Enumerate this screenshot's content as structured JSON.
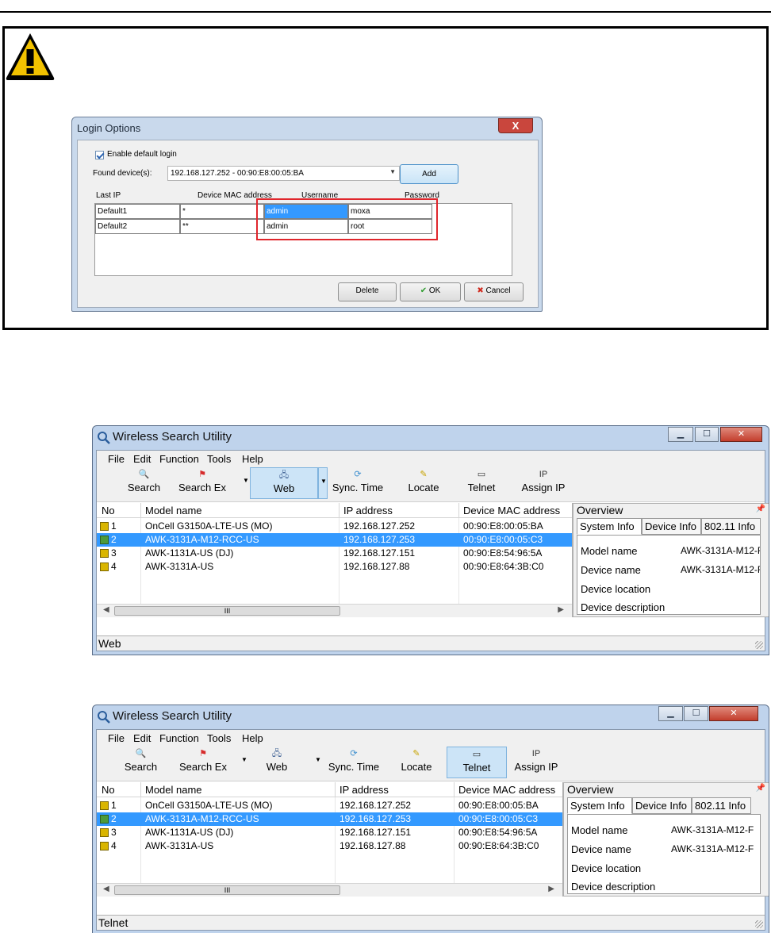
{
  "login_dialog": {
    "title": "Login Options",
    "close_label": "X",
    "enable_default_login": "Enable default login",
    "found_devices_label": "Found device(s):",
    "found_devices_value": "192.168.127.252 - 00:90:E8:00:05:BA",
    "add_button": "Add",
    "columns": [
      "Last IP",
      "Device MAC address",
      "Username",
      "Password"
    ],
    "rows": [
      {
        "last_ip": "Default1",
        "mac": "*",
        "username": "admin",
        "password": "moxa"
      },
      {
        "last_ip": "Default2",
        "mac": "**",
        "username": "admin",
        "password": "root"
      }
    ],
    "delete_button": "Delete",
    "ok_button": "OK",
    "cancel_button": "Cancel"
  },
  "windows": [
    {
      "title": "Wireless Search Utility",
      "menu": [
        "File",
        "Edit",
        "Function",
        "Tools",
        "Help"
      ],
      "toolbar": [
        "Search",
        "Search Ex",
        "Web",
        "Sync. Time",
        "Locate",
        "Telnet",
        "Assign IP"
      ],
      "active_tool": "Web",
      "columns": [
        "No",
        "Model name",
        "IP address",
        "Device MAC address"
      ],
      "rows": [
        {
          "no": "1",
          "model": "OnCell G3150A-LTE-US (MO)",
          "ip": "192.168.127.252",
          "mac": "00:90:E8:00:05:BA"
        },
        {
          "no": "2",
          "model": "AWK-3131A-M12-RCC-US",
          "ip": "192.168.127.253",
          "mac": "00:90:E8:00:05:C3"
        },
        {
          "no": "3",
          "model": "AWK-1131A-US (DJ)",
          "ip": "192.168.127.151",
          "mac": "00:90:E8:54:96:5A"
        },
        {
          "no": "4",
          "model": "AWK-3131A-US",
          "ip": "192.168.127.88",
          "mac": "00:90:E8:64:3B:C0"
        }
      ],
      "selected_row": 2,
      "overview": {
        "title": "Overview",
        "pin": "ᵽ",
        "tabs": [
          "System Info",
          "Device Info",
          "802.11 Info"
        ],
        "fields": [
          "Model name",
          "Device name",
          "Device location",
          "Device description"
        ],
        "model_name_value": "AWK-3131A-M12-F",
        "device_name_value": "AWK-3131A-M12-F"
      },
      "scroll_thumb": "III",
      "status": "Web"
    },
    {
      "title": "Wireless Search Utility",
      "menu": [
        "File",
        "Edit",
        "Function",
        "Tools",
        "Help"
      ],
      "toolbar": [
        "Search",
        "Search Ex",
        "Web",
        "Sync. Time",
        "Locate",
        "Telnet",
        "Assign IP"
      ],
      "active_tool": "Telnet",
      "columns": [
        "No",
        "Model name",
        "IP address",
        "Device MAC address"
      ],
      "rows": [
        {
          "no": "1",
          "model": "OnCell G3150A-LTE-US (MO)",
          "ip": "192.168.127.252",
          "mac": "00:90:E8:00:05:BA"
        },
        {
          "no": "2",
          "model": "AWK-3131A-M12-RCC-US",
          "ip": "192.168.127.253",
          "mac": "00:90:E8:00:05:C3"
        },
        {
          "no": "3",
          "model": "AWK-1131A-US (DJ)",
          "ip": "192.168.127.151",
          "mac": "00:90:E8:54:96:5A"
        },
        {
          "no": "4",
          "model": "AWK-3131A-US",
          "ip": "192.168.127.88",
          "mac": "00:90:E8:64:3B:C0"
        }
      ],
      "selected_row": 2,
      "overview": {
        "title": "Overview",
        "pin": "ᵽ",
        "tabs": [
          "System Info",
          "Device Info",
          "802.11 Info"
        ],
        "fields": [
          "Model name",
          "Device name",
          "Device location",
          "Device description"
        ],
        "model_name_value": "AWK-3131A-M12-F",
        "device_name_value": "AWK-3131A-M12-F"
      },
      "scroll_thumb": "III",
      "status": "Telnet"
    }
  ],
  "colors": {
    "selection": "#3399ff",
    "highlight_box": "#e0262c",
    "warning_yellow": "#f2c200",
    "active_tool": "#cce4f7"
  }
}
